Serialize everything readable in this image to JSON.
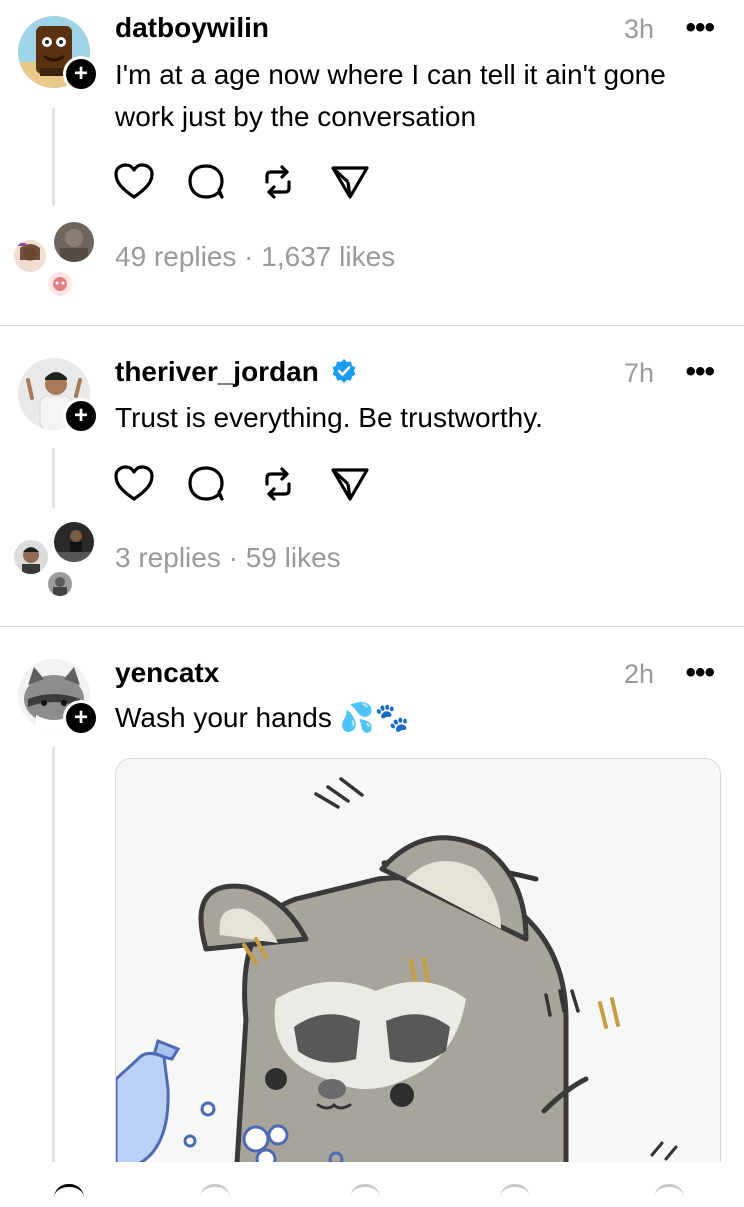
{
  "posts": [
    {
      "username": "datboywilin",
      "time": "3h",
      "more": "•••",
      "text": "I'm at a age now where I can tell it ain't gone work just by the conversation",
      "stats": "49 replies · 1,637 likes"
    },
    {
      "username": "theriver_jordan",
      "verified": true,
      "time": "7h",
      "more": "•••",
      "text": "Trust is everything. Be trustworthy.",
      "stats": "3 replies · 59 likes"
    },
    {
      "username": "yencatx",
      "time": "2h",
      "more": "•••",
      "text": "Wash your hands 💦🐾",
      "media_alt": "raccoon washing hands illustration"
    }
  ],
  "icons": {
    "like": "heart-icon",
    "reply": "comment-icon",
    "repost": "repost-icon",
    "share": "send-icon",
    "follow": "plus-icon",
    "verified": "verified-badge-icon"
  },
  "colors": {
    "verified": "#1d9bf0",
    "muted": "#999999",
    "divider": "#dcdcdc"
  }
}
